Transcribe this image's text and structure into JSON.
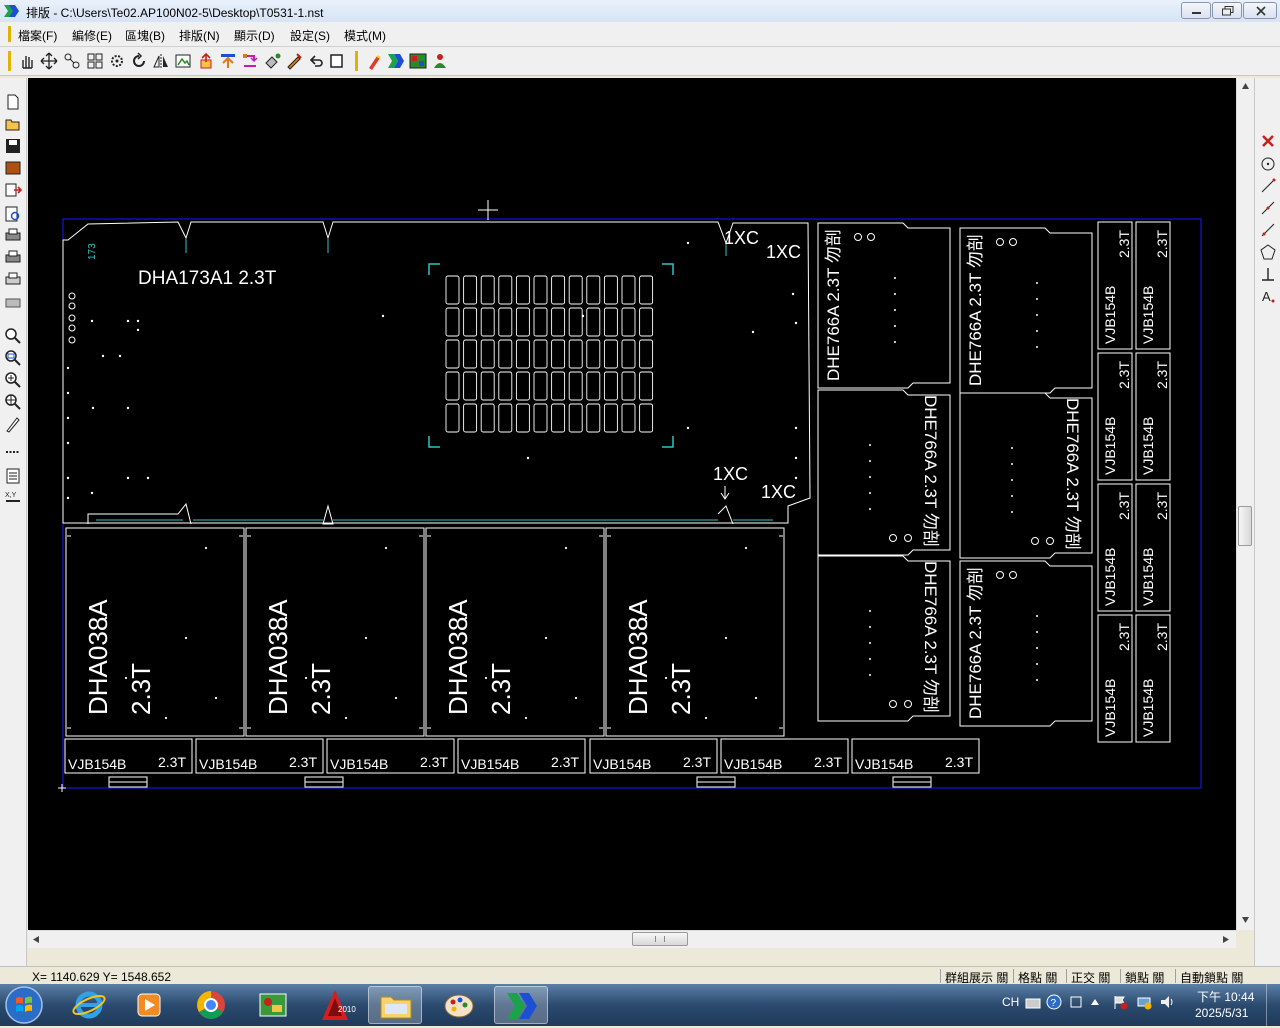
{
  "window": {
    "title": "排版 - C:\\Users\\Te02.AP100N02-5\\Desktop\\T0531-1.nst"
  },
  "menu": [
    "檔案(F)",
    "編修(E)",
    "區塊(B)",
    "排版(N)",
    "顯示(D)",
    "設定(S)",
    "模式(M)"
  ],
  "canvas": {
    "labels": {
      "main_part": "DHA173A1  2.3T",
      "main_part_tag": "173",
      "xc": "1XC",
      "dha038_name": "DHA038A",
      "thickness": "2.3T",
      "dhe_name": "DHE766A",
      "dhe_note": "勿剖",
      "vjb_name": "VJB154B"
    },
    "colors": {
      "background": "#000000",
      "part_outline": "#ffffff",
      "sheet_border": "#1a1aff",
      "accent": "#2ec4c4"
    }
  },
  "statusbar": {
    "coords": "X= 1140.629  Y= 1548.652",
    "flags": [
      "群組展示 關",
      "格點 關",
      "正交 關",
      "鎖點 關",
      "自動鎖點 關"
    ]
  },
  "tray": {
    "lang": "CH",
    "time": "下午 10:44",
    "date": "2025/5/31"
  },
  "taskbar_icons": [
    "start-orb-icon",
    "ie-icon",
    "media-player-icon",
    "chrome-icon",
    "green-app-icon",
    "autocad-icon",
    "explorer-folder-icon",
    "paint-icon",
    "nesting-app-icon"
  ]
}
